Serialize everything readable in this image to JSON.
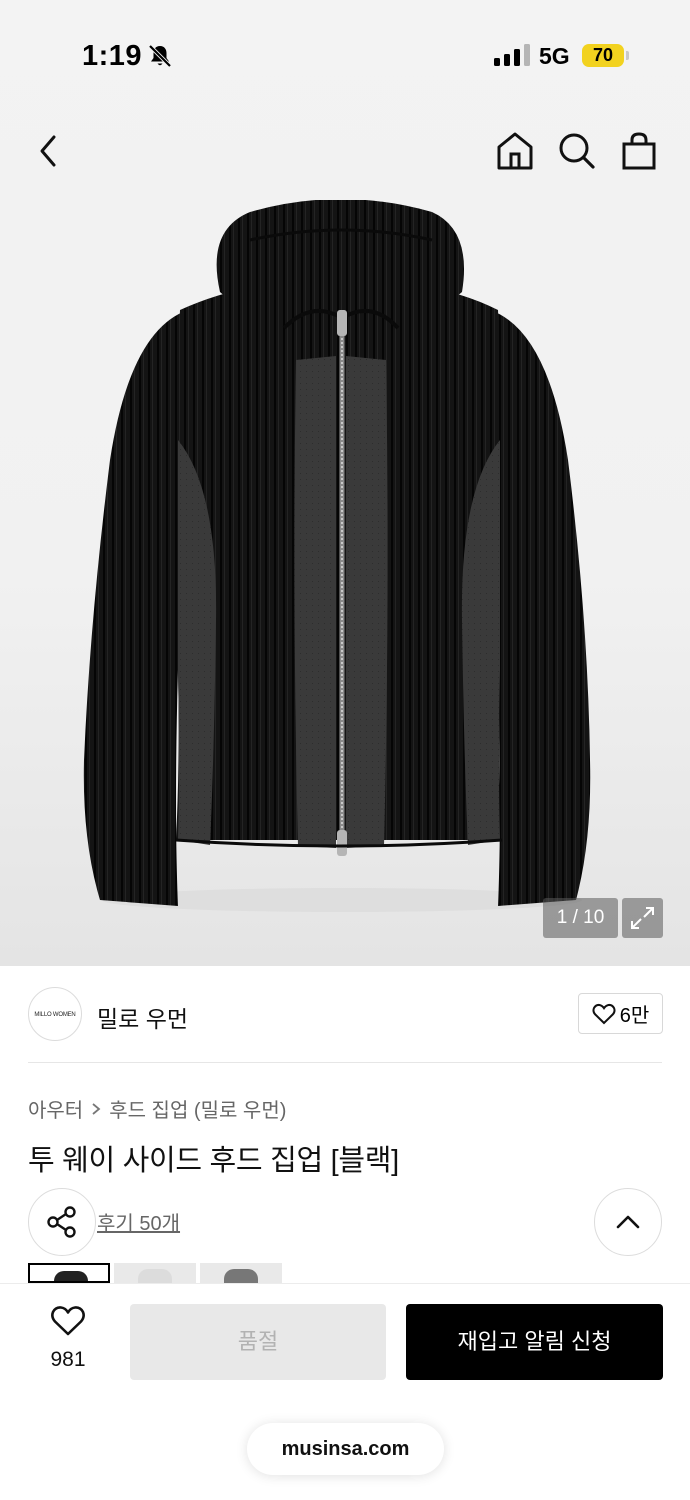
{
  "status_bar": {
    "time": "1:19",
    "network": "5G",
    "battery": "70"
  },
  "nav": {
    "back_icon": "chevron-left-icon",
    "home_icon": "home-icon",
    "search_icon": "search-icon",
    "bag_icon": "bag-icon"
  },
  "gallery": {
    "counter": "1 / 10",
    "expand_icon": "expand-icon"
  },
  "brand": {
    "logo_text": "MILLO WOMEN",
    "name": "밀로 우먼",
    "likes": "6만"
  },
  "breadcrumb": {
    "category": "아우터",
    "subcategory": "후드 집업 (밀로 우먼)"
  },
  "product": {
    "title": "투 웨이 사이드 후드 집업 [블랙]",
    "reviews": "후기 50개"
  },
  "bottom_bar": {
    "wish_count": "981",
    "soldout_label": "품절",
    "restock_label": "재입고 알림 신청",
    "url": "musinsa.com"
  },
  "colors": {
    "accent": "#000000",
    "battery": "#f2d21f",
    "disabled_bg": "#e8e8e8"
  }
}
